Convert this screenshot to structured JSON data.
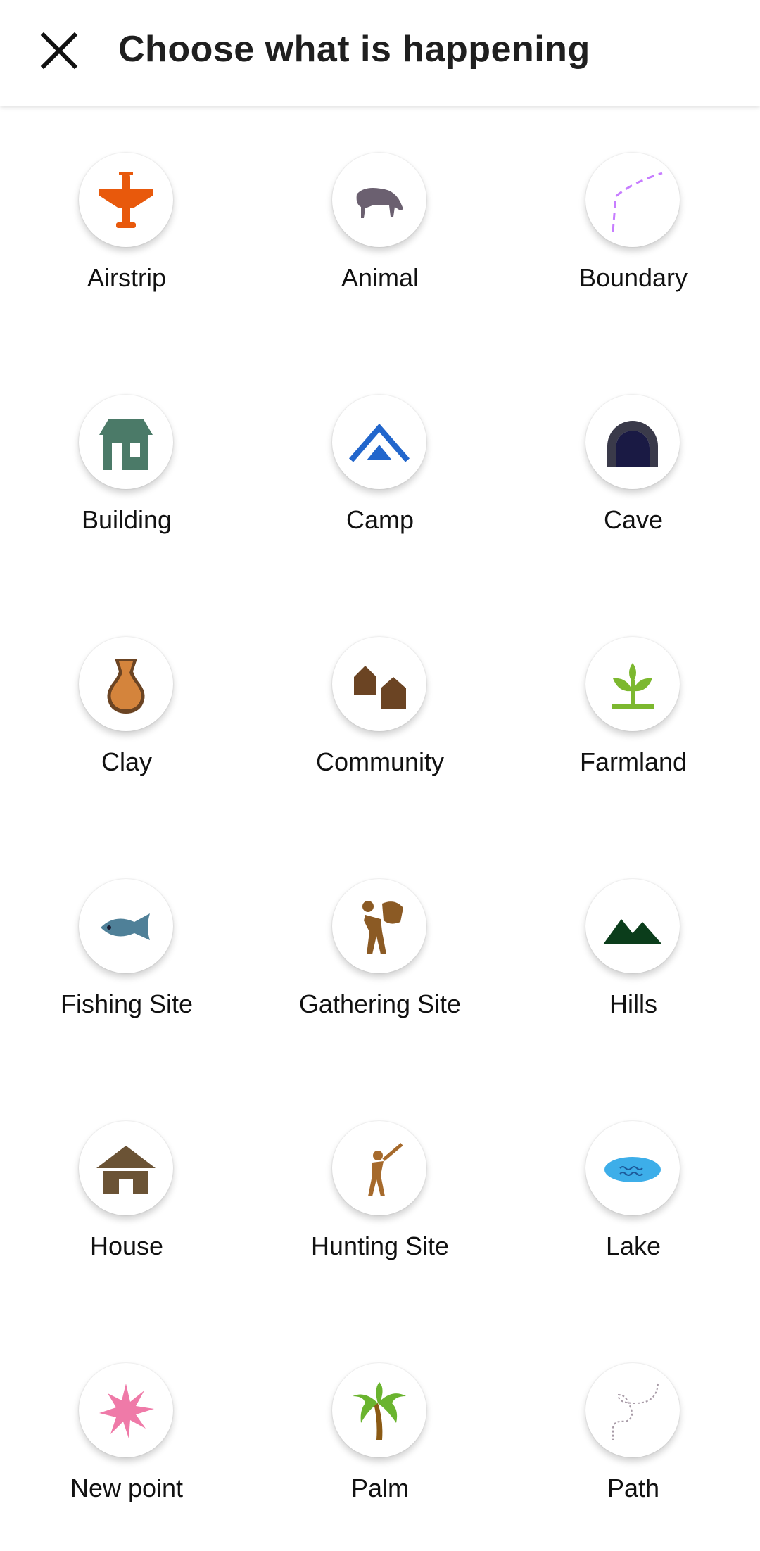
{
  "header": {
    "title": "Choose what is happening",
    "close_icon": "close-icon"
  },
  "items": [
    {
      "label": "Airstrip",
      "icon": "airplane-icon",
      "color": "#e8590c"
    },
    {
      "label": "Animal",
      "icon": "animal-icon",
      "color": "#6b6070"
    },
    {
      "label": "Boundary",
      "icon": "boundary-icon",
      "color": "#c77dff"
    },
    {
      "label": "Building",
      "icon": "building-icon",
      "color": "#4b7a68"
    },
    {
      "label": "Camp",
      "icon": "camp-icon",
      "color": "#2266cc"
    },
    {
      "label": "Cave",
      "icon": "cave-icon",
      "color": "#2b2b44"
    },
    {
      "label": "Clay",
      "icon": "clay-pot-icon",
      "color": "#d4843c"
    },
    {
      "label": "Community",
      "icon": "community-icon",
      "color": "#6b4423"
    },
    {
      "label": "Farmland",
      "icon": "farmland-icon",
      "color": "#7cb82f"
    },
    {
      "label": "Fishing Site",
      "icon": "fish-icon",
      "color": "#4f8098"
    },
    {
      "label": "Gathering Site",
      "icon": "gatherer-icon",
      "color": "#8b5a24"
    },
    {
      "label": "Hills",
      "icon": "hills-icon",
      "color": "#0b3d1b"
    },
    {
      "label": "House",
      "icon": "house-icon",
      "color": "#6b5335"
    },
    {
      "label": "Hunting Site",
      "icon": "hunter-icon",
      "color": "#a66a2c"
    },
    {
      "label": "Lake",
      "icon": "lake-icon",
      "color": "#3daee9"
    },
    {
      "label": "New point",
      "icon": "new-point-icon",
      "color": "#ef7aa8"
    },
    {
      "label": "Palm",
      "icon": "palm-icon",
      "color": "#6ab42f"
    },
    {
      "label": "Path",
      "icon": "path-icon",
      "color": "#a79aa6"
    }
  ]
}
